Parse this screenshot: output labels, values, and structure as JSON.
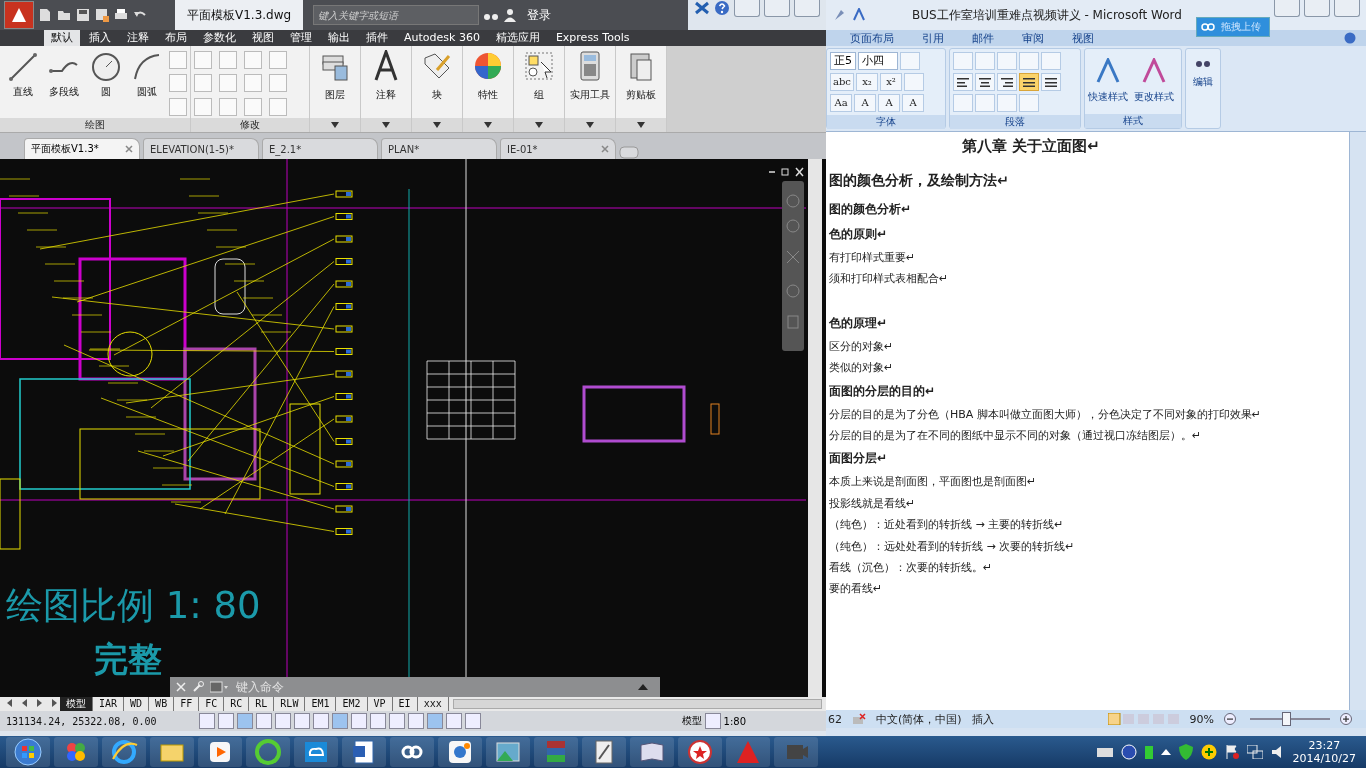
{
  "cad": {
    "title": "平面模板V1.3.dwg",
    "search": {
      "placeholder": "键入关键字或短语"
    },
    "login": "登录",
    "menu_tabs": [
      {
        "label": "默认",
        "selected": true
      },
      {
        "label": "插入",
        "selected": false
      },
      {
        "label": "注释",
        "selected": false
      },
      {
        "label": "布局",
        "selected": false
      },
      {
        "label": "参数化",
        "selected": false
      },
      {
        "label": "视图",
        "selected": false
      },
      {
        "label": "管理",
        "selected": false
      },
      {
        "label": "输出",
        "selected": false
      },
      {
        "label": "插件",
        "selected": false
      },
      {
        "label": "Autodesk 360",
        "selected": false
      },
      {
        "label": "精选应用",
        "selected": false
      },
      {
        "label": "Express Tools",
        "selected": false
      }
    ],
    "draw_panel": {
      "title": "绘图",
      "tools": [
        "直线",
        "多段线",
        "圆",
        "圆弧"
      ]
    },
    "modify_panel": {
      "title": "修改"
    },
    "big_tools": [
      "图层",
      "注释",
      "块",
      "特性",
      "组",
      "实用工具",
      "剪贴板"
    ],
    "doc_tabs": [
      {
        "label": "平面模板V1.3*",
        "selected": true,
        "close_button": true
      },
      {
        "label": "ELEVATION(1-5)*",
        "selected": false,
        "close_button": false
      },
      {
        "label": "E_2.1*",
        "selected": false,
        "close_button": false
      },
      {
        "label": "PLAN*",
        "selected": false,
        "close_button": false
      },
      {
        "label": "IE-01*",
        "selected": false,
        "close_button": true
      }
    ],
    "canvas": {
      "scale_text": "绘图比例 1: 80",
      "caption": "完整"
    },
    "command_line": {
      "placeholder": "键入命令"
    },
    "layout_tabs": [
      {
        "label": "模型",
        "selected": true
      },
      {
        "label": "IAR",
        "selected": false
      },
      {
        "label": "WD",
        "selected": false
      },
      {
        "label": "WB",
        "selected": false
      },
      {
        "label": "FF",
        "selected": false
      },
      {
        "label": "FC",
        "selected": false
      },
      {
        "label": "RC",
        "selected": false
      },
      {
        "label": "RL",
        "selected": false
      },
      {
        "label": "RLW",
        "selected": false
      },
      {
        "label": "EM1",
        "selected": false
      },
      {
        "label": "EM2",
        "selected": false
      },
      {
        "label": "VP",
        "selected": false
      },
      {
        "label": "EI",
        "selected": false
      },
      {
        "label": "xxx",
        "selected": false
      }
    ],
    "status_bar": {
      "coordinates": "131134.24, 25322.08, 0.00",
      "space": "模型",
      "scale": "1:80"
    }
  },
  "word": {
    "title": "BUS工作室培训重难点视频讲义 - Microsoft Word",
    "upload_button": "拖拽上传",
    "tabs": [
      {
        "label": "页面布局",
        "selected": false
      },
      {
        "label": "引用",
        "selected": false
      },
      {
        "label": "邮件",
        "selected": false
      },
      {
        "label": "审阅",
        "selected": false
      },
      {
        "label": "视图",
        "selected": false
      }
    ],
    "font_name": "正5",
    "font_size": "小四",
    "font_buttons": [
      "abc",
      "x₂",
      "x²"
    ],
    "font_buttons_row3": [
      "Aa",
      "A",
      "A",
      "A"
    ],
    "alignment": [
      {
        "kind": "left",
        "selected": false
      },
      {
        "kind": "center",
        "selected": false
      },
      {
        "kind": "right",
        "selected": false
      },
      {
        "kind": "justify",
        "selected": true
      },
      {
        "kind": "distributed",
        "selected": false
      }
    ],
    "styles": [
      "快速样式",
      "更改样式"
    ],
    "editing": "编辑",
    "groups": [
      "字体",
      "段落",
      "样式"
    ],
    "lines": [
      {
        "text": "第八章  关于立面图↵",
        "kind": "chapter",
        "space_before": false
      },
      {
        "text": "图的颜色分析，及绘制方法↵",
        "kind": "heading1",
        "space_before": false
      },
      {
        "text": "图的颜色分析↵",
        "kind": "heading2",
        "space_before": false
      },
      {
        "text": "色的原则↵",
        "kind": "heading2",
        "space_before": false
      },
      {
        "text": "有打印样式重要↵",
        "kind": "body",
        "space_before": false
      },
      {
        "text": "须和打印样式表相配合↵",
        "kind": "body",
        "space_before": false
      },
      {
        "text": "色的原理↵",
        "kind": "heading2",
        "space_before": true
      },
      {
        "text": "区分的对象↵",
        "kind": "body",
        "space_before": false
      },
      {
        "text": "类似的对象↵",
        "kind": "body",
        "space_before": false
      },
      {
        "text": "面图的分层的目的↵",
        "kind": "heading2",
        "space_before": false
      },
      {
        "text": "分层的目的是为了分色（HBA 脚本叫做立面图大师），分色决定了不同对象的打印效果↵",
        "kind": "body",
        "space_before": false
      },
      {
        "text": "分层的目的是为了在不同的图纸中显示不同的对象（通过视口冻结图层）。↵",
        "kind": "body",
        "space_before": false
      },
      {
        "text": "面图分层↵",
        "kind": "heading2",
        "space_before": false
      },
      {
        "text": "本质上来说是剖面图，平面图也是剖面图↵",
        "kind": "body",
        "space_before": false
      },
      {
        "text": "投影线就是看线↵",
        "kind": "body",
        "space_before": false
      },
      {
        "text": "（纯色）：近处看到的转折线 → 主要的转折线↵",
        "kind": "body",
        "space_before": false
      },
      {
        "text": "（纯色）：远处处看到的转折线 → 次要的转折线↵",
        "kind": "body",
        "space_before": false
      },
      {
        "text": "看线（沉色）：次要的转折线。↵",
        "kind": "body",
        "space_before": false
      },
      {
        "text": "要的看线↵",
        "kind": "body",
        "space_before": false
      }
    ],
    "status_bar": {
      "page": "62",
      "language": "中文(简体，中国)",
      "mode": "插入",
      "zoom": "90%",
      "zoom_slider": {
        "level": 0.45
      }
    }
  },
  "taskbar": {
    "time": "23:27",
    "date": "2014/10/27"
  }
}
